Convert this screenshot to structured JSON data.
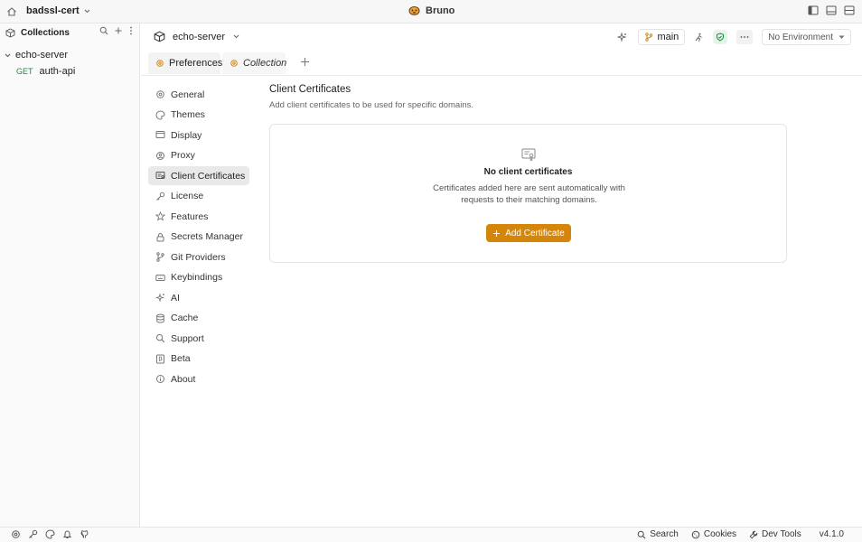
{
  "titlebar": {
    "workspace": "badssl-cert",
    "app_name": "Bruno"
  },
  "sidebar": {
    "title": "Collections",
    "collection": "echo-server",
    "requests": [
      {
        "method": "GET",
        "name": "auth-api"
      }
    ]
  },
  "header": {
    "collection_name": "echo-server",
    "branch": "main",
    "environment": "No Environment"
  },
  "tabs": [
    {
      "label": "Preferences"
    },
    {
      "label": "Collection"
    }
  ],
  "settings_nav": [
    {
      "label": "General",
      "icon": "gear-icon"
    },
    {
      "label": "Themes",
      "icon": "palette-icon"
    },
    {
      "label": "Display",
      "icon": "monitor-icon"
    },
    {
      "label": "Proxy",
      "icon": "proxy-icon"
    },
    {
      "label": "Client Certificates",
      "icon": "certificate-icon",
      "active": true
    },
    {
      "label": "License",
      "icon": "key-icon"
    },
    {
      "label": "Features",
      "icon": "star-icon"
    },
    {
      "label": "Secrets Manager",
      "icon": "lock-icon"
    },
    {
      "label": "Git Providers",
      "icon": "git-branch-icon"
    },
    {
      "label": "Keybindings",
      "icon": "keyboard-icon"
    },
    {
      "label": "AI",
      "icon": "sparkles-icon"
    },
    {
      "label": "Cache",
      "icon": "database-icon"
    },
    {
      "label": "Support",
      "icon": "search-icon"
    },
    {
      "label": "Beta",
      "icon": "beta-icon"
    },
    {
      "label": "About",
      "icon": "info-icon"
    }
  ],
  "content": {
    "title": "Client Certificates",
    "subtitle": "Add client certificates to be used for specific domains.",
    "empty_title": "No client certificates",
    "empty_desc": "Certificates added here are sent automatically with requests to their matching domains.",
    "add_button": "Add Certificate"
  },
  "statusbar": {
    "search": "Search",
    "cookies": "Cookies",
    "devtools": "Dev Tools",
    "version": "v4.1.0"
  },
  "colors": {
    "accent": "#d4860b",
    "method_get": "#1b8a3a"
  }
}
